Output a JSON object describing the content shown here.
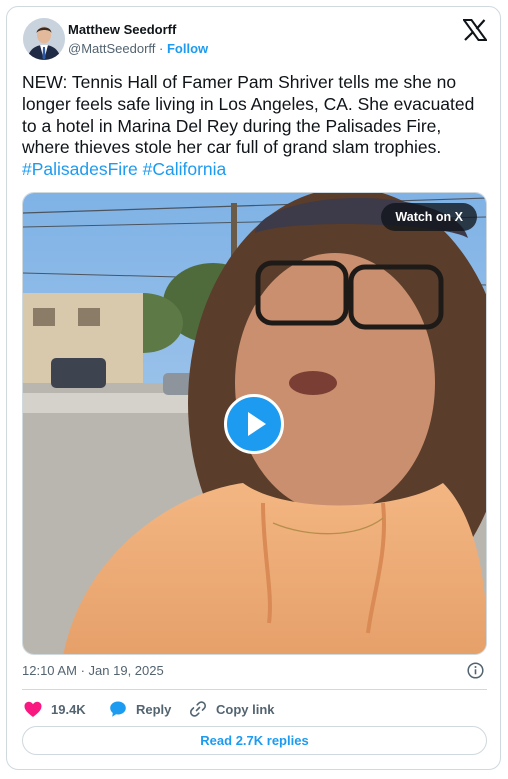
{
  "author": {
    "name": "Matthew Seedorff",
    "handle": "@MattSeedorff",
    "separator": "·",
    "follow_label": "Follow"
  },
  "brand_logo": "x-logo-icon",
  "tweet": {
    "text": "NEW: Tennis Hall of Famer Pam Shriver tells me she no longer feels safe living in Los Angeles, CA.  She evacuated to a hotel in Marina Del Rey during the Palisades Fire, where thieves stole her car full of grand slam trophies.",
    "hashtags": [
      "#PalisadesFire",
      "#California"
    ]
  },
  "media": {
    "watch_label": "Watch on X",
    "play_icon": "play-icon"
  },
  "meta": {
    "time": "12:10 AM",
    "separator": "·",
    "date": "Jan 19, 2025",
    "info_icon": "info-icon"
  },
  "actions": {
    "likes": "19.4K",
    "reply_label": "Reply",
    "copy_label": "Copy link"
  },
  "read_replies_label": "Read 2.7K replies",
  "colors": {
    "accent": "#1d9bf0",
    "like": "#f91880",
    "text": "#0f1419",
    "muted": "#536471",
    "border": "#cfd9de"
  }
}
